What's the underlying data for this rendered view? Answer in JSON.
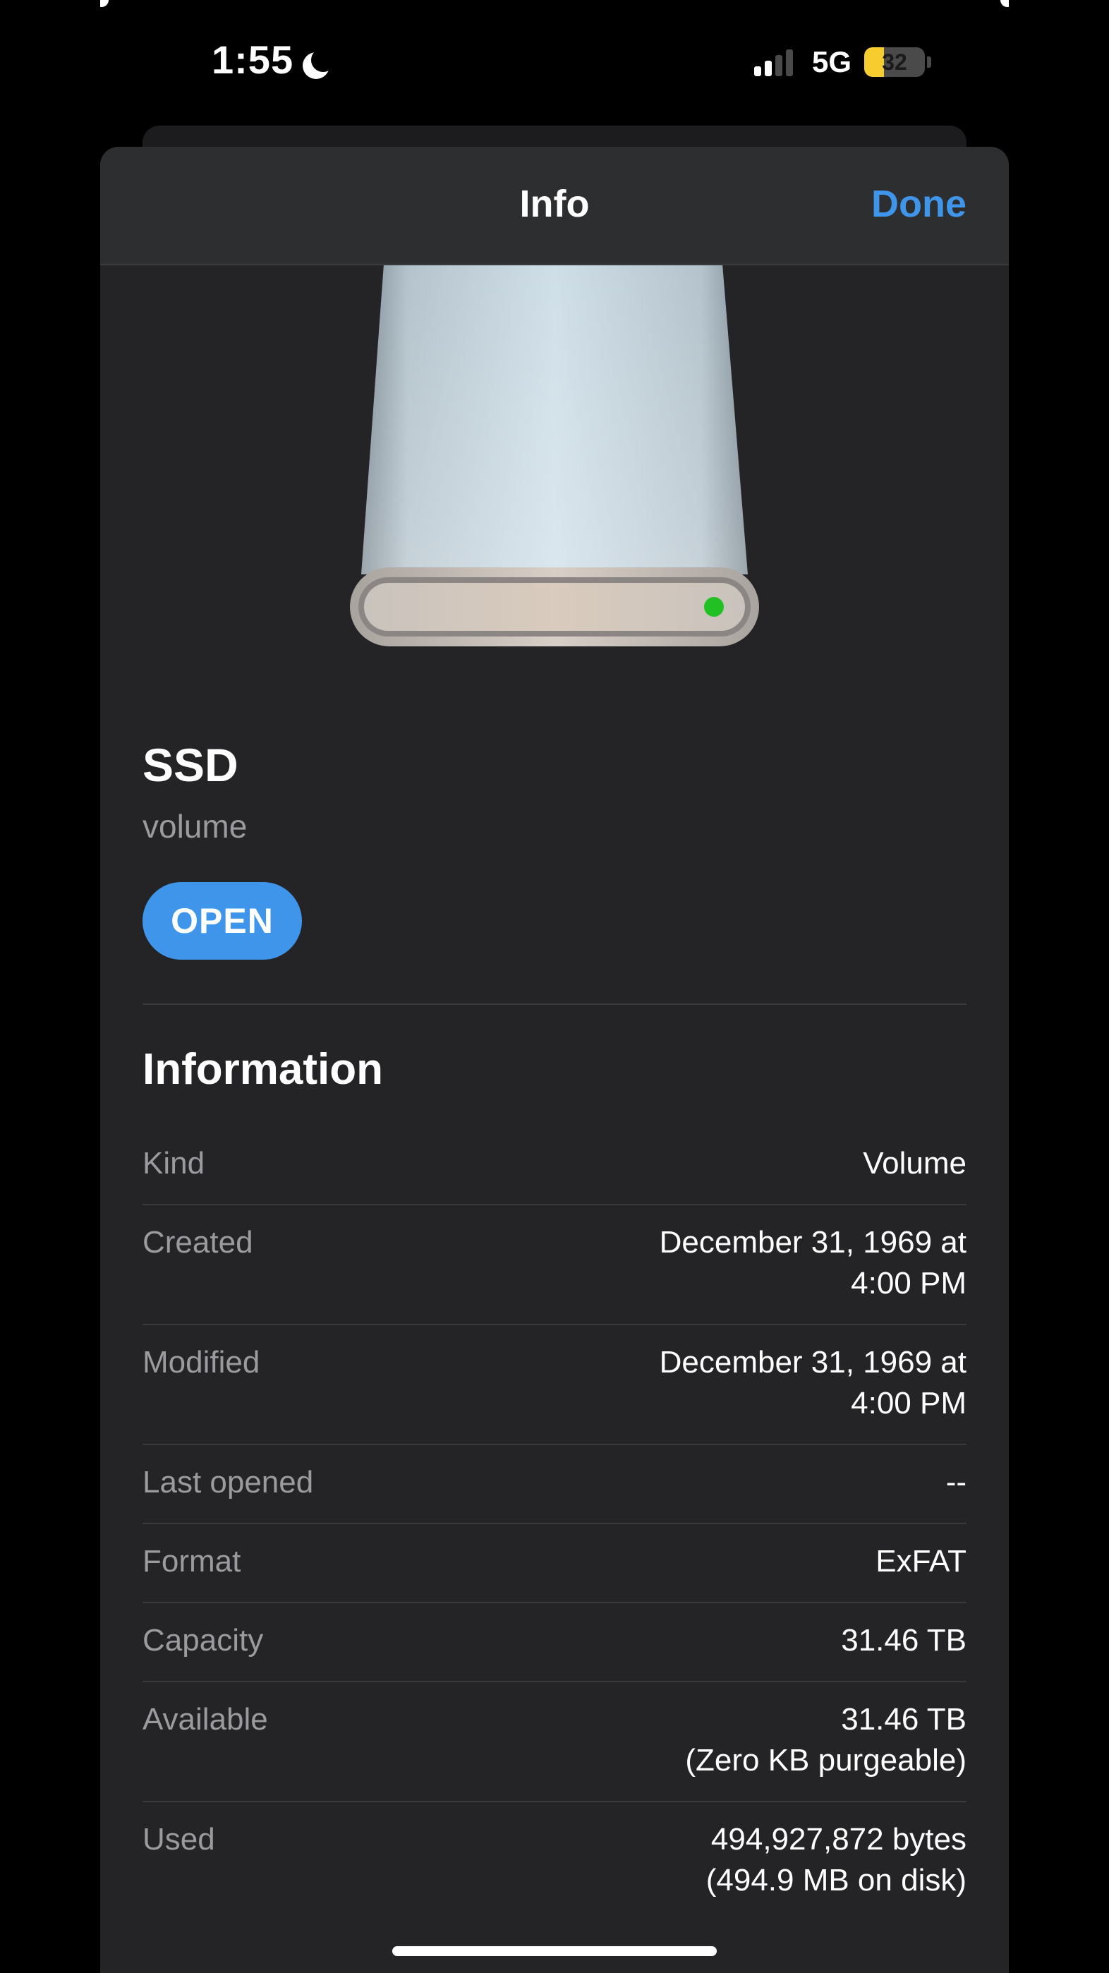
{
  "status_bar": {
    "time": "1:55",
    "network": "5G",
    "battery_level": "32",
    "icons": [
      "moon-icon",
      "signal-icon",
      "battery-icon"
    ]
  },
  "nav": {
    "title": "Info",
    "done_label": "Done"
  },
  "item": {
    "name": "SSD",
    "kind": "volume",
    "open_label": "OPEN",
    "icon": "external-drive-icon"
  },
  "section": {
    "title": "Information"
  },
  "info_rows": [
    {
      "label": "Kind",
      "value": [
        "Volume"
      ]
    },
    {
      "label": "Created",
      "value": [
        "December 31, 1969 at",
        "4:00 PM"
      ]
    },
    {
      "label": "Modified",
      "value": [
        "December 31, 1969 at",
        "4:00 PM"
      ]
    },
    {
      "label": "Last opened",
      "value": [
        "--"
      ]
    },
    {
      "label": "Format",
      "value": [
        "ExFAT"
      ]
    },
    {
      "label": "Capacity",
      "value": [
        "31.46 TB"
      ]
    },
    {
      "label": "Available",
      "value": [
        "31.46 TB",
        "(Zero KB purgeable)"
      ]
    },
    {
      "label": "Used",
      "value": [
        "494,927,872 bytes",
        "(494.9 MB on disk)"
      ]
    }
  ],
  "colors": {
    "accent": "#3f95ea",
    "sheet_background": "#242426",
    "nav_background": "#2c2e2f",
    "secondary_text": "#9a9a9f",
    "battery": "#f7cc2e",
    "drive_led": "#22c022"
  }
}
